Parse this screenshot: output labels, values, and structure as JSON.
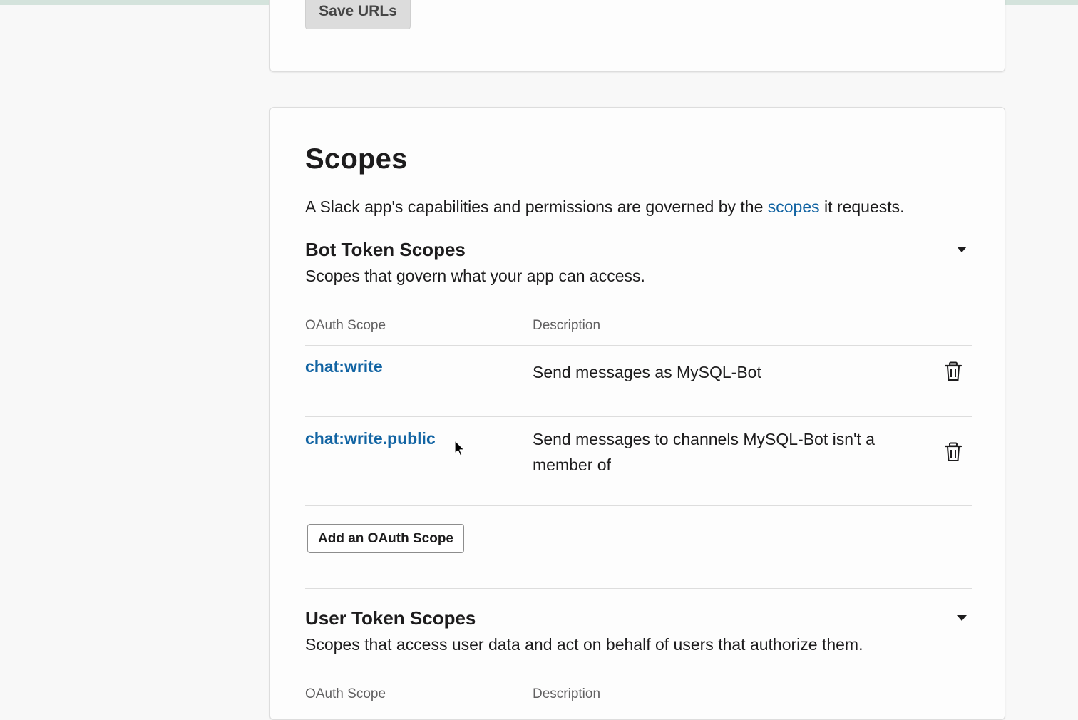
{
  "top_card": {
    "save_urls_label": "Save URLs"
  },
  "scopes": {
    "title": "Scopes",
    "desc_before": "A Slack app's capabilities and permissions are governed by the ",
    "desc_link": "scopes",
    "desc_after": " it requests."
  },
  "bot_section": {
    "title": "Bot Token Scopes",
    "subtitle": "Scopes that govern what your app can access.",
    "col_scope": "OAuth Scope",
    "col_desc": "Description",
    "rows": [
      {
        "scope": "chat:write",
        "description": "Send messages as MySQL-Bot"
      },
      {
        "scope": "chat:write.public",
        "description": "Send messages to channels MySQL-Bot isn't a member of"
      }
    ],
    "add_button": "Add an OAuth Scope"
  },
  "user_section": {
    "title": "User Token Scopes",
    "subtitle": "Scopes that access user data and act on behalf of users that authorize them.",
    "col_scope": "OAuth Scope",
    "col_desc": "Description"
  },
  "icons": {
    "collapse": "caret-down-icon",
    "delete": "trash-icon",
    "pointer": "mouse-cursor"
  },
  "colors": {
    "link": "#1264a3",
    "text": "#1d1c1d",
    "muted": "#616061",
    "page_bg": "#f8f8f8"
  }
}
